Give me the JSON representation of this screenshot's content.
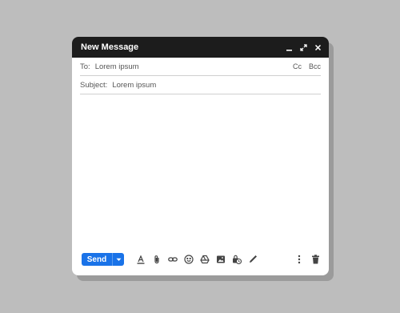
{
  "window": {
    "title": "New Message",
    "controls": [
      "minimize-icon",
      "expand-icon",
      "close-icon"
    ]
  },
  "to": {
    "label": "To:",
    "value": "Lorem ipsum",
    "cc": "Cc",
    "bcc": "Bcc"
  },
  "subject": {
    "label": "Subject:",
    "value": "Lorem ipsum"
  },
  "body": {
    "value": ""
  },
  "toolbar": {
    "send_label": "Send",
    "icons": [
      "formatting-icon",
      "attach-icon",
      "link-icon",
      "emoji-icon",
      "drive-icon",
      "photo-icon",
      "confidential-icon",
      "signature-icon"
    ],
    "right_icons": [
      "more-options-icon",
      "trash-icon"
    ]
  },
  "colors": {
    "accent": "#1a73e8",
    "titlebar": "#1c1c1c",
    "background": "#bdbdbd",
    "icon": "#444444"
  }
}
